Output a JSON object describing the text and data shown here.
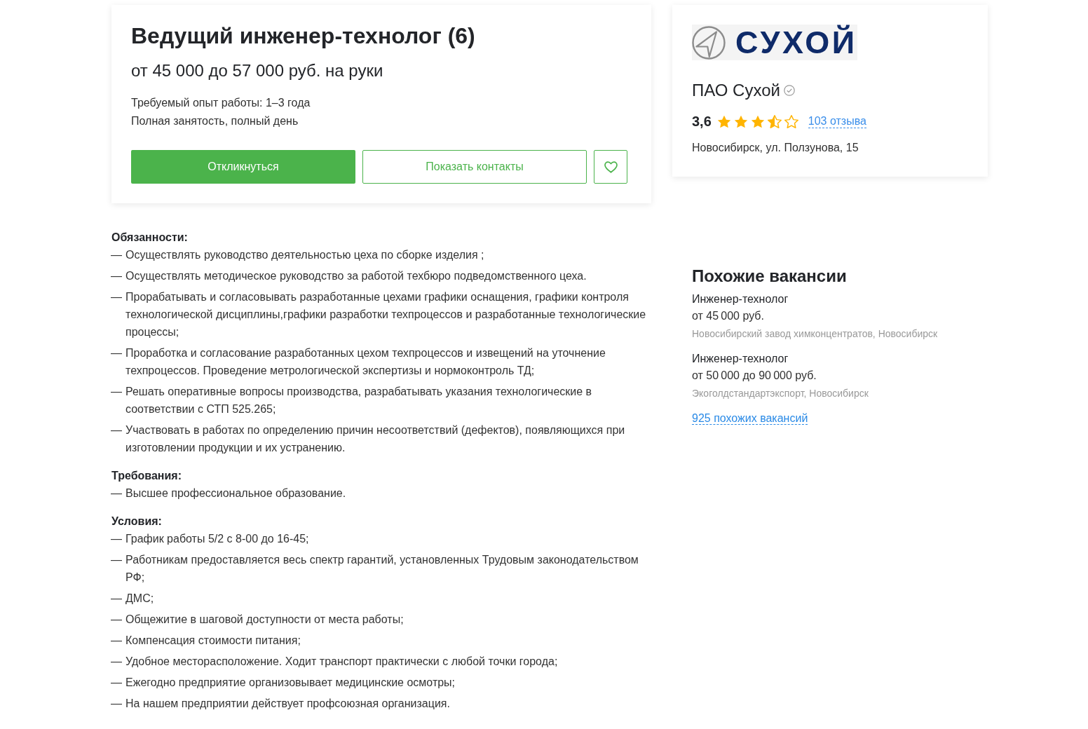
{
  "vacancy": {
    "title": "Ведущий инженер-технолог (6)",
    "salary": "от 45 000 до 57 000 руб. на руки",
    "details": [
      "Требуемый опыт работы: 1–3 года",
      "Полная занятость, полный день"
    ],
    "actions": [
      {
        "kind": "primary",
        "label": "Откликнуться"
      },
      {
        "kind": "outline",
        "label": "Показать контакты"
      }
    ],
    "favorite": false
  },
  "company": {
    "logo_text": "СУХОЙ",
    "name": "ПАО Сухой",
    "verified": true,
    "rating": "3,6",
    "stars": 3.5,
    "reviews_link": "103 отзыва",
    "address": "Новосибирск, ул. Ползунова, 15"
  },
  "description": {
    "sections": [
      {
        "heading": "Обязанности:",
        "items": [
          {
            "marker": "—",
            "text": "Осуществлять руководство деятельностью цеха по сборке изделия ;"
          },
          {
            "marker": "—",
            "text": "Осуществлять методическое руководство за работой техбюро подведомственного цеха."
          },
          {
            "marker": "—",
            "text": "Прорабатывать и согласовывать разработанные цехами графики оснащения, графики контроля технологической дисциплины,графики разработки техпроцессов и разработанные технологические процессы;"
          },
          {
            "marker": "—",
            "text": "Проработка и согласование разработанных цехом техпроцессов и извещений на уточнение техпроцессов. Проведение метрологической экспертизы и нормоконтроль ТД;"
          },
          {
            "marker": "—",
            "text": "Решать оперативные вопросы производства, разрабатывать указания технологические в соответствии с СТП 525.265;"
          },
          {
            "marker": "—",
            "text": "Участвовать в работах по определению причин несоответствий (дефектов), появляющихся при изготовлении продукции и их устранению."
          }
        ]
      },
      {
        "heading": "Требования:",
        "items": [
          {
            "marker": "—",
            "text": "Высшее профессиональное образование."
          }
        ]
      },
      {
        "heading": "Условия:",
        "items": [
          {
            "marker": "—",
            "text": "График работы 5/2 с 8-00 до 16-45;"
          },
          {
            "marker": "—",
            "text": "Работникам предоставляется весь спектр гарантий, установленных Трудовым законодательством РФ;"
          },
          {
            "marker": "—",
            "text": "ДМС;"
          },
          {
            "marker": "—",
            "text": "Общежитие в шаговой доступности от места работы;"
          },
          {
            "marker": "—",
            "text": "Компенсация стоимости питания;"
          },
          {
            "marker": "—",
            "text": "Удобное месторасположение. Ходит транспорт практически с любой точки города;"
          },
          {
            "marker": "—",
            "text": "Ежегодно предприятие организовывает медицинские осмотры;"
          },
          {
            "marker": "—",
            "text": "На нашем предприятии действует профсоюзная организация."
          }
        ]
      }
    ]
  },
  "similar": {
    "title": "Похожие вакансии",
    "vacancies": [
      {
        "title": "Инженер-технолог",
        "salary": "от 45 000 руб.",
        "employer": "Новосибирский завод химконцентратов, Новосибирск"
      },
      {
        "title": "Инженер-технолог",
        "salary": "от 50 000 до 90 000 руб.",
        "employer": "Экоголдстандартэкспорт, Новосибирск"
      }
    ],
    "more_link": "925 похожих вакансий"
  }
}
